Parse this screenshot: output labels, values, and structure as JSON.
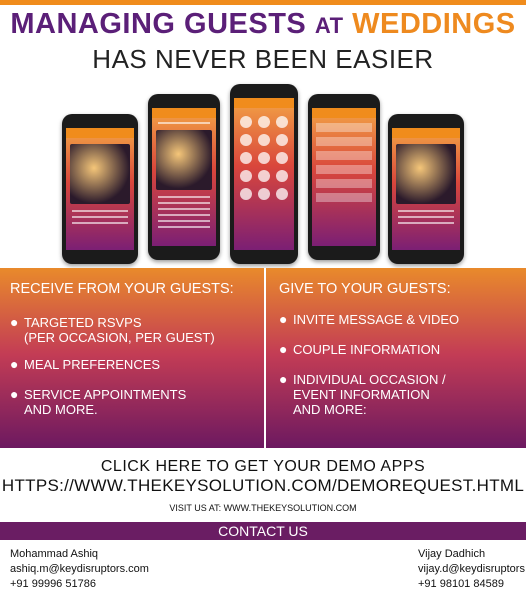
{
  "header": {
    "line1_part1": "MANAGING GUESTS",
    "line1_part2": "AT",
    "line1_part3": "WEDDINGS",
    "line2": "HAS NEVER BEEN EASIER"
  },
  "left_column": {
    "heading": "RECEIVE FROM YOUR GUESTS:",
    "items": [
      {
        "text1": "TARGETED RSVPS",
        "text2": "(PER OCCASION, PER GUEST)"
      },
      {
        "text1": "MEAL PREFERENCES",
        "text2": ""
      },
      {
        "text1": "SERVICE APPOINTMENTS",
        "text2": "AND MORE."
      }
    ]
  },
  "right_column": {
    "heading": "GIVE TO YOUR GUESTS:",
    "items": [
      {
        "text1": "INVITE MESSAGE & VIDEO",
        "text2": "",
        "text3": ""
      },
      {
        "text1": "COUPLE INFORMATION",
        "text2": "",
        "text3": ""
      },
      {
        "text1": "INDIVIDUAL OCCASION /",
        "text2": "EVENT INFORMATION",
        "text3": "AND MORE:"
      }
    ]
  },
  "bullet_char": "●",
  "cta": {
    "line1": "CLICK HERE TO GET YOUR DEMO APPS",
    "url": "HTTPS://WWW.THEKEYSOLUTION.COM/DEMOREQUEST.HTML",
    "visit": "VISIT US AT: WWW.THEKEYSOLUTION.COM"
  },
  "contact": {
    "title": "CONTACT US",
    "person1": {
      "name": "Mohammad Ashiq",
      "email": "ashiq.m@keydisruptors.com",
      "phone": "+91 99996 51786"
    },
    "person2": {
      "name": "Vijay Dadhich",
      "email": "vijay.d@keydisruptors",
      "phone": "+91 98101 84589"
    }
  },
  "colors": {
    "purple": "#5b1f78",
    "orange": "#ee8a1f",
    "band_top": "#e98a2b",
    "band_bottom": "#6c1960"
  }
}
